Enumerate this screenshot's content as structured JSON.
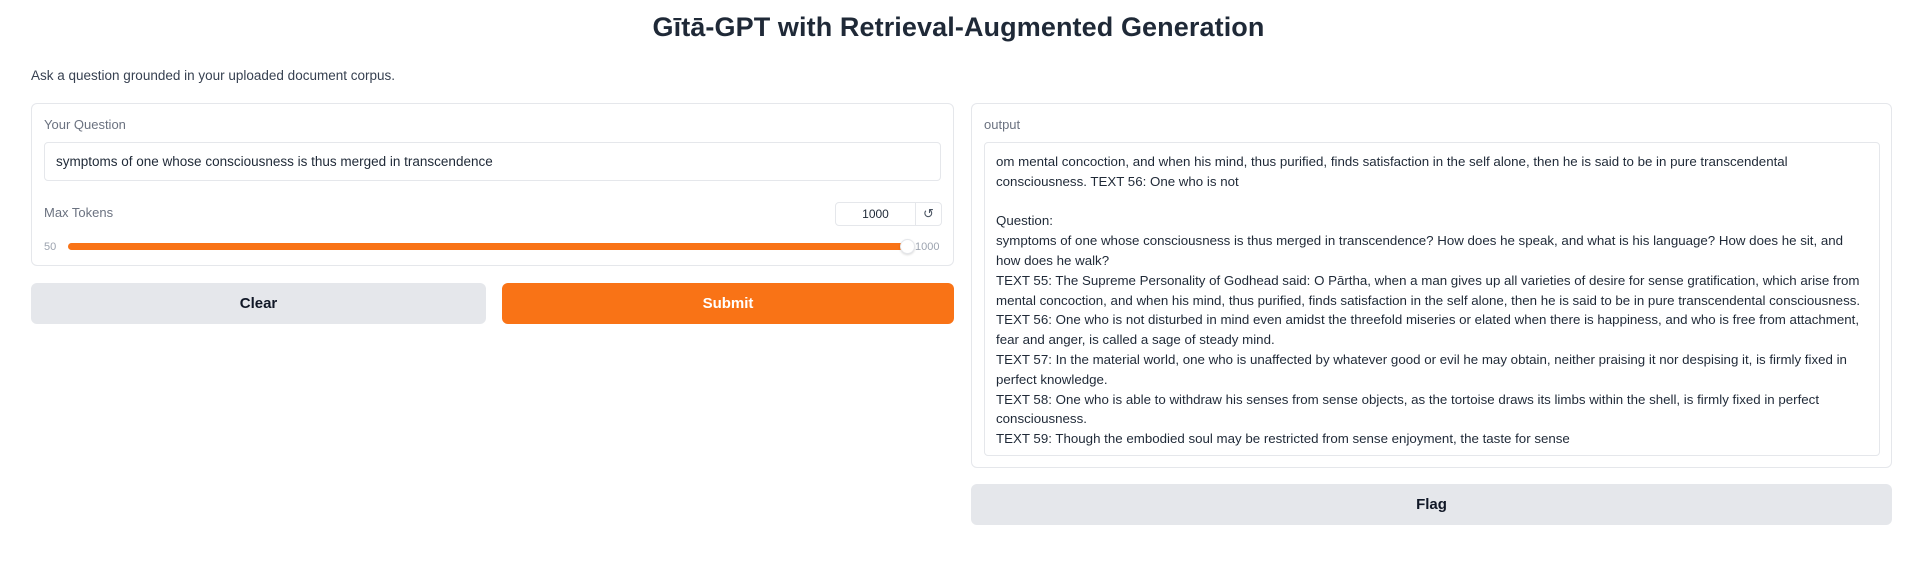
{
  "header": {
    "title": "Gītā-GPT with Retrieval-Augmented Generation",
    "subtitle": "Ask a question grounded in your uploaded document corpus."
  },
  "question": {
    "label": "Your Question",
    "value": "symptoms of one whose consciousness is thus merged in transcendence"
  },
  "max_tokens": {
    "label": "Max Tokens",
    "value": "1000",
    "min": "50",
    "max": "1000",
    "fill_fraction": 1.0,
    "reset_icon": "reset-icon"
  },
  "buttons": {
    "clear": "Clear",
    "submit": "Submit",
    "flag": "Flag"
  },
  "output": {
    "label": "output",
    "text": "om mental concoction, and when his mind, thus purified, finds satisfaction in the self alone, then he is said to be in pure transcendental consciousness. TEXT 56: One who is not\n\nQuestion:\nsymptoms of one whose consciousness is thus merged in transcendence? How does he speak, and what is his language? How does he sit, and how does he walk?\nTEXT 55: The Supreme Personality of Godhead said: O Pārtha, when a man gives up all varieties of desire for sense gratification, which arise from mental concoction, and when his mind, thus purified, finds satisfaction in the self alone, then he is said to be in pure transcendental consciousness.\nTEXT 56: One who is not disturbed in mind even amidst the threefold miseries or elated when there is happiness, and who is free from attachment, fear and anger, is called a sage of steady mind.\nTEXT 57: In the material world, one who is unaffected by whatever good or evil he may obtain, neither praising it nor despising it, is firmly fixed in perfect knowledge.\nTEXT 58: One who is able to withdraw his senses from sense objects, as the tortoise draws its limbs within the shell, is firmly fixed in perfect consciousness.\nTEXT 59: Though the embodied soul may be restricted from sense enjoyment, the taste for sense"
  },
  "colors": {
    "accent": "#f97316",
    "secondary_button": "#e5e7eb",
    "border": "#e5e7eb"
  }
}
